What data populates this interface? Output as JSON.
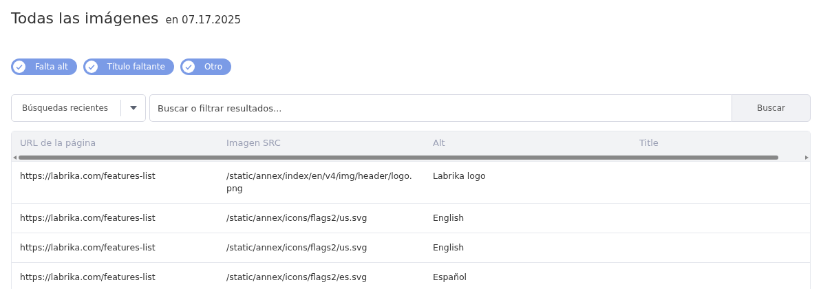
{
  "header": {
    "title": "Todas las imágenes",
    "date": "en 07.17.2025"
  },
  "filters": [
    {
      "label": "Falta alt",
      "checked": true
    },
    {
      "label": "Título faltante",
      "checked": true
    },
    {
      "label": "Otro",
      "checked": true
    }
  ],
  "search": {
    "recent": "Búsquedas recientes",
    "placeholder": "Buscar o filtrar resultados...",
    "button": "Buscar"
  },
  "table": {
    "columns": [
      "URL de la página",
      "Imagen SRC",
      "Alt",
      "Title"
    ],
    "rows": [
      [
        "https://labrika.com/features-list",
        "/static/annex/index/en/v4/img/header/logo.png",
        "Labrika logo",
        ""
      ],
      [
        "https://labrika.com/features-list",
        "/static/annex/icons/flags2/us.svg",
        "English",
        ""
      ],
      [
        "https://labrika.com/features-list",
        "/static/annex/icons/flags2/us.svg",
        "English",
        ""
      ],
      [
        "https://labrika.com/features-list",
        "/static/annex/icons/flags2/es.svg",
        "Español",
        ""
      ]
    ]
  }
}
